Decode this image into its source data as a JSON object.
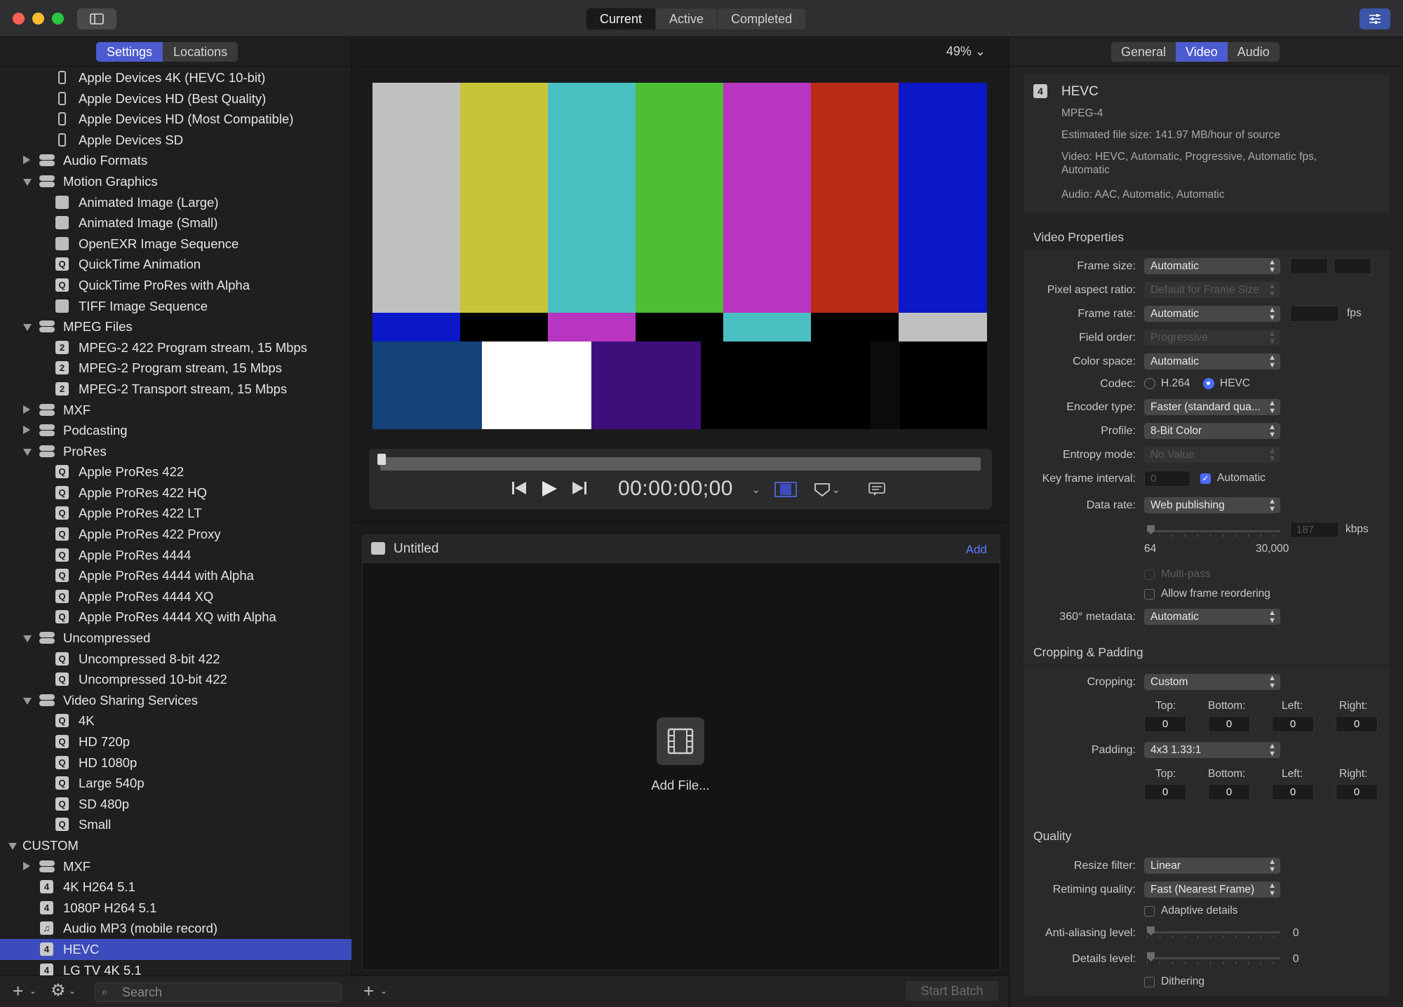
{
  "window": {
    "tabs": [
      {
        "label": "Current",
        "active": true
      },
      {
        "label": "Active",
        "active": false
      },
      {
        "label": "Completed",
        "active": false
      }
    ]
  },
  "left": {
    "tabs": [
      {
        "label": "Settings",
        "active": true
      },
      {
        "label": "Locations",
        "active": false
      }
    ],
    "search_placeholder": "Search"
  },
  "tree": [
    {
      "label": "Apple Devices 4K (HEVC 10-bit)",
      "level": 2,
      "icon": "phone-icon"
    },
    {
      "label": "Apple Devices HD (Best Quality)",
      "level": 2,
      "icon": "phone-icon"
    },
    {
      "label": "Apple Devices HD (Most Compatible)",
      "level": 2,
      "icon": "phone-icon"
    },
    {
      "label": "Apple Devices SD",
      "level": 2,
      "icon": "phone-icon"
    },
    {
      "label": "Audio Formats",
      "level": 1,
      "icon": "group-icon",
      "disclosure": "collapsed"
    },
    {
      "label": "Motion Graphics",
      "level": 1,
      "icon": "group-icon",
      "disclosure": "expanded"
    },
    {
      "label": "Animated Image (Large)",
      "level": 2,
      "icon": "image-icon"
    },
    {
      "label": "Animated Image (Small)",
      "level": 2,
      "icon": "image-icon"
    },
    {
      "label": "OpenEXR Image Sequence",
      "level": 2,
      "icon": "image-icon"
    },
    {
      "label": "QuickTime Animation",
      "level": 2,
      "icon": "quicktime-icon",
      "glyph": "Q"
    },
    {
      "label": "QuickTime ProRes with Alpha",
      "level": 2,
      "icon": "quicktime-icon",
      "glyph": "Q"
    },
    {
      "label": "TIFF Image Sequence",
      "level": 2,
      "icon": "image-icon"
    },
    {
      "label": "MPEG Files",
      "level": 1,
      "icon": "group-icon",
      "disclosure": "expanded"
    },
    {
      "label": "MPEG-2 422 Program stream, 15 Mbps",
      "level": 2,
      "icon": "mpeg2-icon",
      "glyph": "2"
    },
    {
      "label": "MPEG-2 Program stream, 15 Mbps",
      "level": 2,
      "icon": "mpeg2-icon",
      "glyph": "2"
    },
    {
      "label": "MPEG-2 Transport stream, 15 Mbps",
      "level": 2,
      "icon": "mpeg2-icon",
      "glyph": "2"
    },
    {
      "label": "MXF",
      "level": 1,
      "icon": "group-icon",
      "disclosure": "collapsed"
    },
    {
      "label": "Podcasting",
      "level": 1,
      "icon": "group-icon",
      "disclosure": "collapsed"
    },
    {
      "label": "ProRes",
      "level": 1,
      "icon": "group-icon",
      "disclosure": "expanded"
    },
    {
      "label": "Apple ProRes 422",
      "level": 2,
      "icon": "quicktime-icon",
      "glyph": "Q"
    },
    {
      "label": "Apple ProRes 422 HQ",
      "level": 2,
      "icon": "quicktime-icon",
      "glyph": "Q"
    },
    {
      "label": "Apple ProRes 422 LT",
      "level": 2,
      "icon": "quicktime-icon",
      "glyph": "Q"
    },
    {
      "label": "Apple ProRes 422 Proxy",
      "level": 2,
      "icon": "quicktime-icon",
      "glyph": "Q"
    },
    {
      "label": "Apple ProRes 4444",
      "level": 2,
      "icon": "quicktime-icon",
      "glyph": "Q"
    },
    {
      "label": "Apple ProRes 4444 with Alpha",
      "level": 2,
      "icon": "quicktime-icon",
      "glyph": "Q"
    },
    {
      "label": "Apple ProRes 4444 XQ",
      "level": 2,
      "icon": "quicktime-icon",
      "glyph": "Q"
    },
    {
      "label": "Apple ProRes 4444 XQ with Alpha",
      "level": 2,
      "icon": "quicktime-icon",
      "glyph": "Q"
    },
    {
      "label": "Uncompressed",
      "level": 1,
      "icon": "group-icon",
      "disclosure": "expanded"
    },
    {
      "label": "Uncompressed 8-bit 422",
      "level": 2,
      "icon": "quicktime-icon",
      "glyph": "Q"
    },
    {
      "label": "Uncompressed 10-bit 422",
      "level": 2,
      "icon": "quicktime-icon",
      "glyph": "Q"
    },
    {
      "label": "Video Sharing Services",
      "level": 1,
      "icon": "group-icon",
      "disclosure": "expanded"
    },
    {
      "label": "4K",
      "level": 2,
      "icon": "quicktime-icon",
      "glyph": "Q"
    },
    {
      "label": "HD 720p",
      "level": 2,
      "icon": "quicktime-icon",
      "glyph": "Q"
    },
    {
      "label": "HD 1080p",
      "level": 2,
      "icon": "quicktime-icon",
      "glyph": "Q"
    },
    {
      "label": "Large 540p",
      "level": 2,
      "icon": "quicktime-icon",
      "glyph": "Q"
    },
    {
      "label": "SD 480p",
      "level": 2,
      "icon": "quicktime-icon",
      "glyph": "Q"
    },
    {
      "label": "Small",
      "level": 2,
      "icon": "quicktime-icon",
      "glyph": "Q"
    },
    {
      "label": "CUSTOM",
      "level": 0,
      "disclosure": "expanded"
    },
    {
      "label": "MXF",
      "level": 1,
      "icon": "group-icon",
      "disclosure": "collapsed"
    },
    {
      "label": "4K H264 5.1",
      "level": 1,
      "icon": "mpeg4-icon",
      "glyph": "4"
    },
    {
      "label": "1080P H264 5.1",
      "level": 1,
      "icon": "mpeg4-icon",
      "glyph": "4"
    },
    {
      "label": "Audio MP3 (mobile record)",
      "level": 1,
      "icon": "music-icon",
      "glyph": "♫"
    },
    {
      "label": "HEVC",
      "level": 1,
      "icon": "mpeg4-icon",
      "glyph": "4",
      "selected": true
    },
    {
      "label": "LG TV 4K 5.1",
      "level": 1,
      "icon": "mpeg4-icon",
      "glyph": "4"
    }
  ],
  "center": {
    "zoom": "49%",
    "timecode": "00:00:00;00",
    "batch_title": "Untitled",
    "batch_add": "Add",
    "add_file": "Add File...",
    "start_batch": "Start Batch"
  },
  "right": {
    "tabs": [
      {
        "label": "General",
        "active": false
      },
      {
        "label": "Video",
        "active": true
      },
      {
        "label": "Audio",
        "active": false
      }
    ],
    "summary": {
      "badge": "4",
      "name": "HEVC",
      "container": "MPEG-4",
      "file_size": "Estimated file size: 141.97 MB/hour of source",
      "video": "Video: HEVC, Automatic, Progressive, Automatic fps, Automatic",
      "audio": "Audio: AAC, Automatic, Automatic"
    },
    "video_properties": {
      "title": "Video Properties",
      "frame_size_label": "Frame size:",
      "frame_size": "Automatic",
      "pixel_aspect_label": "Pixel aspect ratio:",
      "pixel_aspect": "Default for Frame Size",
      "frame_rate_label": "Frame rate:",
      "frame_rate": "Automatic",
      "fps": "fps",
      "field_order_label": "Field order:",
      "field_order": "Progressive",
      "color_space_label": "Color space:",
      "color_space": "Automatic",
      "codec_label": "Codec:",
      "codec_h264": "H.264",
      "codec_hevc": "HEVC",
      "codec_selected": "HEVC",
      "encoder_type_label": "Encoder type:",
      "encoder_type": "Faster (standard qua...",
      "profile_label": "Profile:",
      "profile": "8-Bit Color",
      "entropy_label": "Entropy mode:",
      "entropy": "No Value",
      "key_frame_label": "Key frame interval:",
      "key_frame_value": "0",
      "key_frame_auto": "Automatic",
      "data_rate_label": "Data rate:",
      "data_rate": "Web publishing",
      "data_rate_value": "187",
      "kbps": "kbps",
      "data_rate_min": "64",
      "data_rate_max": "30,000",
      "multipass": "Multi-pass",
      "frame_reordering": "Allow frame reordering",
      "metadata_label": "360° metadata:",
      "metadata": "Automatic"
    },
    "cropping": {
      "title": "Cropping & Padding",
      "cropping_label": "Cropping:",
      "cropping": "Custom",
      "padding_label": "Padding:",
      "padding": "4x3 1.33:1",
      "top": "Top:",
      "bottom": "Bottom:",
      "left": "Left:",
      "right": "Right:",
      "crop_values": [
        "0",
        "0",
        "0",
        "0"
      ],
      "pad_values": [
        "0",
        "0",
        "0",
        "0"
      ]
    },
    "quality": {
      "title": "Quality",
      "resize_label": "Resize filter:",
      "resize": "Linear",
      "retiming_label": "Retiming quality:",
      "retiming": "Fast (Nearest Frame)",
      "adaptive": "Adaptive details",
      "antialias_label": "Anti-aliasing level:",
      "antialias_value": "0",
      "details_label": "Details level:",
      "details_value": "0",
      "dithering": "Dithering"
    }
  },
  "colors": {
    "accent": "#4d5bd0",
    "selection": "#3d4cbd",
    "link": "#5b78ff"
  }
}
